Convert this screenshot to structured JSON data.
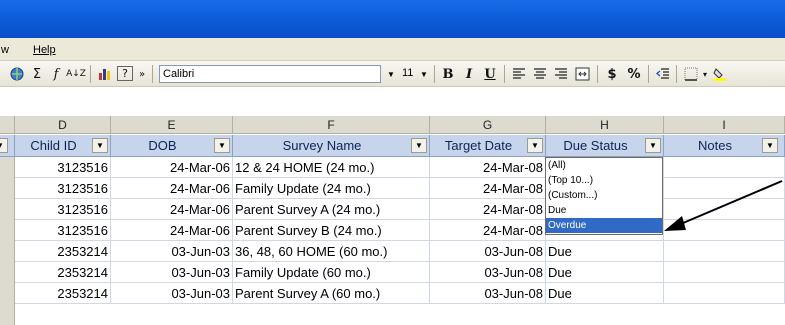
{
  "menubar": {
    "items": [
      "w",
      "Help"
    ]
  },
  "toolbar": {
    "font_name": "Calibri",
    "font_size": "11",
    "bold": "B",
    "italic": "I",
    "underline": "U",
    "currency": "$",
    "percent": "%",
    "sigma": "Σ",
    "fx": "f",
    "sort": "A↓Z",
    "help": "?",
    "more": "»"
  },
  "columns": [
    "D",
    "E",
    "F",
    "G",
    "H",
    "I"
  ],
  "headers": {
    "child_id": "Child ID",
    "dob": "DOB",
    "survey_name": "Survey Name",
    "target_date": "Target Date",
    "due_status": "Due Status",
    "notes": "Notes"
  },
  "rows": [
    {
      "child_id": "3123516",
      "dob": "24-Mar-06",
      "survey": "12 & 24 HOME (24 mo.)",
      "target": "24-Mar-08",
      "status": ""
    },
    {
      "child_id": "3123516",
      "dob": "24-Mar-06",
      "survey": "Family Update (24 mo.)",
      "target": "24-Mar-08",
      "status": ""
    },
    {
      "child_id": "3123516",
      "dob": "24-Mar-06",
      "survey": "Parent Survey A (24 mo.)",
      "target": "24-Mar-08",
      "status": ""
    },
    {
      "child_id": "3123516",
      "dob": "24-Mar-06",
      "survey": "Parent Survey B (24 mo.)",
      "target": "24-Mar-08",
      "status": "Overdue"
    },
    {
      "child_id": "2353214",
      "dob": "03-Jun-03",
      "survey": "36, 48, 60 HOME (60 mo.)",
      "target": "03-Jun-08",
      "status": "Due"
    },
    {
      "child_id": "2353214",
      "dob": "03-Jun-03",
      "survey": "Family Update (60 mo.)",
      "target": "03-Jun-08",
      "status": "Due"
    },
    {
      "child_id": "2353214",
      "dob": "03-Jun-03",
      "survey": "Parent Survey A (60 mo.)",
      "target": "03-Jun-08",
      "status": "Due"
    }
  ],
  "filter_dropdown": {
    "options": [
      "(All)",
      "(Top 10...)",
      "(Custom...)",
      "Due",
      "Overdue"
    ],
    "selected": "Overdue"
  },
  "colors": {
    "title_bar": "#0b5ad8",
    "header_fill": "#c6d5eb",
    "selection": "#316ac5"
  }
}
